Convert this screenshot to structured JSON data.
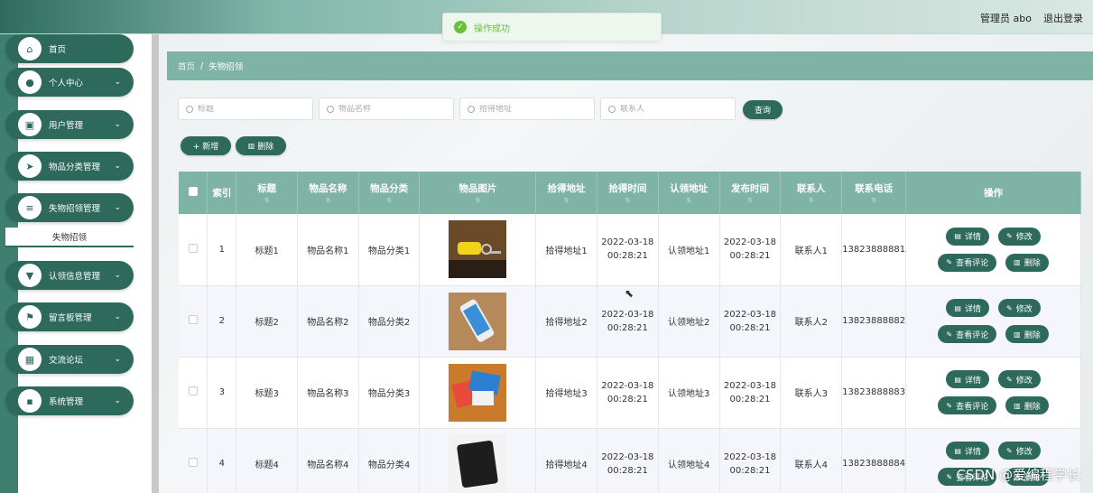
{
  "header": {
    "title": "",
    "user": "管理员 abo",
    "logout": "退出登录"
  },
  "toast": {
    "message": "操作成功"
  },
  "sidebar": {
    "items": [
      {
        "label": "首页",
        "icon": "home-icon",
        "glyph": "⌂",
        "chevron": false
      },
      {
        "label": "个人中心",
        "icon": "user-icon",
        "glyph": "●",
        "chevron": true
      },
      {
        "label": "用户管理",
        "icon": "clipboard-icon",
        "glyph": "▣",
        "chevron": true
      },
      {
        "label": "物品分类管理",
        "icon": "send-icon",
        "glyph": "➤",
        "chevron": true
      },
      {
        "label": "失物招领管理",
        "icon": "sliders-icon",
        "glyph": "≡",
        "chevron": true
      },
      {
        "label": "认领信息管理",
        "icon": "cup-icon",
        "glyph": "▼",
        "chevron": true
      },
      {
        "label": "留言板管理",
        "icon": "flag-icon",
        "glyph": "⚑",
        "chevron": true
      },
      {
        "label": "交流论坛",
        "icon": "grid-icon",
        "glyph": "▦",
        "chevron": true
      },
      {
        "label": "系统管理",
        "icon": "apps-icon",
        "glyph": "▪",
        "chevron": true
      }
    ],
    "subitem": "失物招领"
  },
  "breadcrumb": {
    "home": "首页",
    "separator": "/",
    "current": "失物招领"
  },
  "search": {
    "title_placeholder": "标题",
    "name_placeholder": "物品名称",
    "address_placeholder": "拾得地址",
    "contact_placeholder": "联系人",
    "query_label": "查询"
  },
  "actions": {
    "add_label": "+ 新增",
    "delete_label": "删除"
  },
  "table": {
    "headers": [
      "索引",
      "标题",
      "物品名称",
      "物品分类",
      "物品图片",
      "拾得地址",
      "拾得时间",
      "认领地址",
      "发布时间",
      "联系人",
      "联系电话",
      "操作"
    ],
    "rows": [
      {
        "index": "1",
        "title": "标题1",
        "name": "物品名称1",
        "category": "物品分类1",
        "image": "keys-photo",
        "address": "拾得地址1",
        "found_time": "2022-03-18 00:28:21",
        "claim_address": "认领地址1",
        "publish_time": "2022-03-18 00:28:21",
        "contact": "联系人1",
        "phone": "13823888881"
      },
      {
        "index": "2",
        "title": "标题2",
        "name": "物品名称2",
        "category": "物品分类2",
        "image": "phone-photo",
        "address": "拾得地址2",
        "found_time": "2022-03-18 00:28:21",
        "claim_address": "认领地址2",
        "publish_time": "2022-03-18 00:28:21",
        "contact": "联系人2",
        "phone": "13823888882"
      },
      {
        "index": "3",
        "title": "标题3",
        "name": "物品名称3",
        "category": "物品分类3",
        "image": "cards-photo",
        "address": "拾得地址3",
        "found_time": "2022-03-18 00:28:21",
        "claim_address": "认领地址3",
        "publish_time": "2022-03-18 00:28:21",
        "contact": "联系人3",
        "phone": "13823888883"
      },
      {
        "index": "4",
        "title": "标题4",
        "name": "物品名称4",
        "category": "物品分类4",
        "image": "wallet-photo",
        "address": "拾得地址4",
        "found_time": "2022-03-18 00:28:21",
        "claim_address": "认领地址4",
        "publish_time": "2022-03-18 00:28:21",
        "contact": "联系人4",
        "phone": "13823888884"
      }
    ],
    "row_actions": {
      "detail": "详情",
      "edit": "修改",
      "comments": "查看评论",
      "delete": "删除"
    }
  },
  "watermark": "CSDN @爱编程学长",
  "colors": {
    "primary": "#2d6a5b",
    "header_bg": "#7fb3a6",
    "success": "#67c23a"
  }
}
